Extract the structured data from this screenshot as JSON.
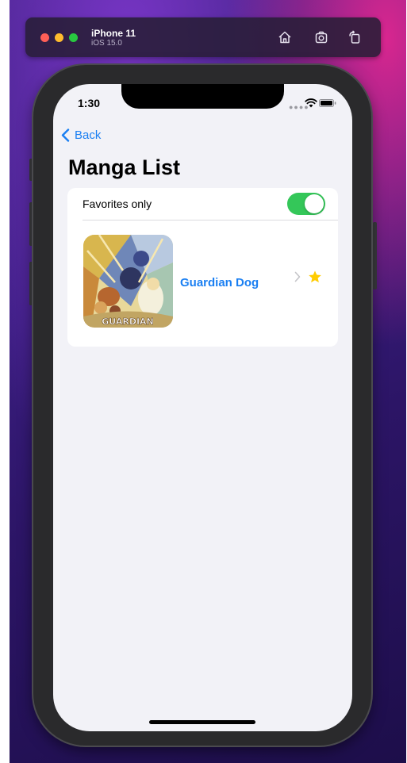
{
  "simulator": {
    "device_name": "iPhone 11",
    "os_version": "iOS 15.0",
    "toolbar_icons": [
      "home-icon",
      "screenshot-icon",
      "rotate-icon"
    ]
  },
  "status_bar": {
    "time": "1:30",
    "icons": [
      "signal-icon",
      "wifi-icon",
      "battery-icon"
    ]
  },
  "nav": {
    "back_label": "Back",
    "title": "Manga List"
  },
  "list": {
    "favorites_toggle": {
      "label": "Favorites only",
      "on": true
    },
    "items": [
      {
        "title": "Guardian Dog",
        "cover_text": "GUARDIAN",
        "favorite": true,
        "icons": [
          "chevron-right-icon",
          "star-icon"
        ]
      }
    ]
  },
  "colors": {
    "accent": "#1a7ff2",
    "toggle_on": "#34c759",
    "star": "#ffcc00",
    "background": "#f2f2f7"
  }
}
